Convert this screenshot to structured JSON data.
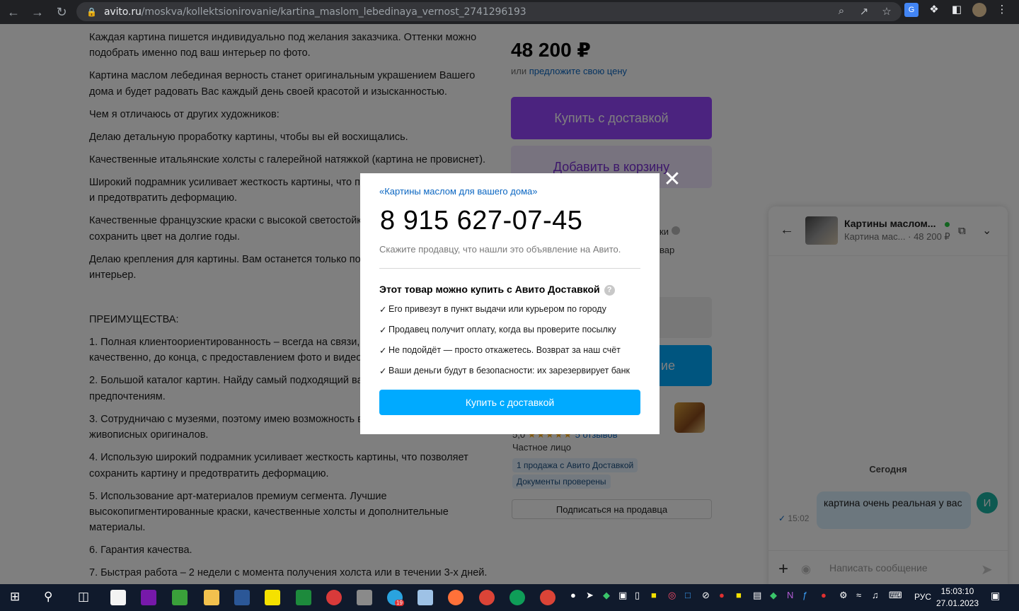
{
  "browser": {
    "url_host": "avito.ru",
    "url_path": "/moskva/kollektsionirovanie/kartina_maslom_lebedinaya_vernost_2741296193",
    "icons": [
      "back-icon",
      "forward-icon",
      "reload-icon",
      "lock-icon",
      "zoom-icon",
      "share-icon",
      "star-icon",
      "translate-icon",
      "puzzle-icon",
      "sidepanel-icon",
      "profile-icon",
      "menu-icon"
    ]
  },
  "description": {
    "paragraphs": [
      "Каждая картина пишется индивидуально под желания заказчика. Оттенки можно подобрать именно под ваш интерьер по фото.",
      "Картина маслом лебединая верность станет оригинальным украшением Вашего дома и будет радовать Вас каждый день своей красотой и изысканностью.",
      "Чем я отличаюсь от других художников:",
      "Делаю детальную проработку картины, чтобы вы ей восхищались.",
      "Качественные итальянские холсты с галерейной натяжкой (картина не провиснет).",
      "Широкий подрамник усиливает жесткость картины, что по",
      "Качественные французские краски с высокой светостойк",
      "Делаю крепления для картины. Вам останется только пов"
    ],
    "p6_line2": "и предотвратить деформацию.",
    "p7_line2": "сохранить цвет на долгие годы.",
    "p8_line2": "интерьер.",
    "advantages_heading": "ПРЕИМУЩЕСТВА:",
    "advantages": [
      "1. Полная клиентоориентированность – всегда на связи,",
      "2. Большой каталог картин. Найду самый подходящий ва",
      "3. Сотрудничаю с музеями, поэтому имею возможность в",
      "4. Использую широкий подрамник усиливает жесткость картины, что позволяет сохранить картину и предотвратить деформацию.",
      "5. Использование арт-материалов премиум сегмента. Лучшие высокопигментированные краски, качественные холсты и дополнительные материалы.",
      "6. Гарантия качества.",
      "7. Быстрая работа – 2 недели с момента получения холста или в течении 3-х дней."
    ],
    "adv1_line2": "качественно, до конца, с предоставлением фото и видео",
    "adv2_line2": "предпочтениям.",
    "adv3_line2": "живописных оригиналов."
  },
  "sidebar": {
    "price": "48 200 ₽",
    "offer_prefix": "или",
    "offer_link": "предложите свою цену",
    "buy_button": "Купить с доставкой",
    "cart_button": "Добавить в корзину",
    "partial_1": "ки",
    "partial_2": "вар",
    "blue_button_partial": "ие",
    "rating_value": "5,0",
    "rating_stars": "★★★★★",
    "reviews": "5 отзывов",
    "seller_type": "Частное лицо",
    "badge_1": "1 продажа с Авито Доставкой",
    "badge_2": "Документы проверены",
    "subscribe": "Подписаться на продавца"
  },
  "chat": {
    "title": "Картины маслом...",
    "subtitle_item": "Картина мас...",
    "subtitle_price": "48 200 ₽",
    "today": "Сегодня",
    "message": "картина очень реальная у вас",
    "time": "15:02",
    "avatar_letter": "И",
    "input_placeholder": "Написать сообщение"
  },
  "modal": {
    "shop_name": "«Картины маслом для вашего дома»",
    "phone": "8 915 627-07-45",
    "hint": "Скажите продавцу, что нашли это объявление на Авито.",
    "delivery_title": "Этот товар можно купить с Авито Доставкой",
    "check": "✓",
    "items": [
      "Его привезут в пункт выдачи или курьером по городу",
      "Продавец получит оплату, когда вы проверите посылку",
      "Не подойдёт — просто откажетесь. Возврат за наш счёт",
      "Ваши деньги будут в безопасности: их зарезервирует банк"
    ],
    "button": "Купить с доставкой"
  },
  "taskbar": {
    "telegram_badge": "19",
    "lang": "РУС",
    "time": "15:03:10",
    "date": "27.01.2023"
  }
}
